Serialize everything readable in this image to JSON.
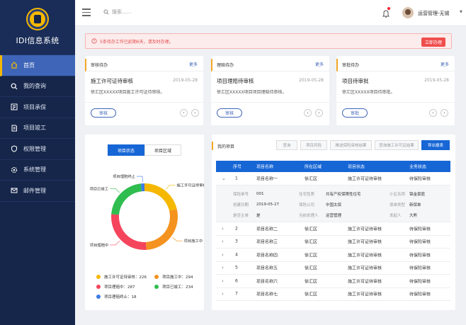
{
  "app": {
    "name": "IDI信息系统"
  },
  "sidebar": {
    "items": [
      {
        "label": "首页",
        "icon": "home-icon",
        "active": true
      },
      {
        "label": "我的查询",
        "icon": "search-icon"
      },
      {
        "label": "项目承保",
        "icon": "document-icon"
      },
      {
        "label": "项目竣工",
        "icon": "file-icon"
      },
      {
        "label": "权限管理",
        "icon": "shield-icon"
      },
      {
        "label": "系统管理",
        "icon": "gear-icon"
      },
      {
        "label": "邮件管理",
        "icon": "mail-icon"
      }
    ]
  },
  "topbar": {
    "search_placeholder": "搜索......",
    "user": "运营管理-无锡"
  },
  "alert": {
    "text": "5条待办工作已延期6天，请及时办理。",
    "action": "立即办理"
  },
  "tasks": [
    {
      "header": "审核待办",
      "more": "更多",
      "title": "施工许可证待审核",
      "date": "2019-05-28",
      "desc": "徐汇区XXXXX项目施工许可证待审核。",
      "button": "审核"
    },
    {
      "header": "理赔待办",
      "more": "更多",
      "title": "项目理赔待审核",
      "date": "2019-05-28",
      "desc": "徐汇区XXXXX项目项目理赔待审核。",
      "button": "审核"
    },
    {
      "header": "审批待办",
      "more": "更多",
      "title": "项目待审批",
      "date": "2019-05-28",
      "desc": "徐汇区XXXXX项目待审批。",
      "button": "审批"
    }
  ],
  "pager": {
    "prev": "‹",
    "next": "›"
  },
  "status_chart": {
    "tabs": [
      "项目状态",
      "项目区域"
    ],
    "chart_data": {
      "type": "pie",
      "categories": [
        "施工许可证待审核",
        "项目施工中",
        "项目理赔中",
        "项目已竣工",
        "项目理赔终止"
      ],
      "values": [
        226,
        294,
        287,
        234,
        18
      ],
      "colors": [
        "#f5b800",
        "#f4931f",
        "#f5455c",
        "#2fbd4f",
        "#3f7be6"
      ],
      "legend": [
        "施工许可证待审核：226",
        "项目施工中：294",
        "项目理赔中：287",
        "项目已竣工：234",
        "项目理赔终止：18"
      ],
      "legend_position": "bottom"
    }
  },
  "projects": {
    "title": "我的项目",
    "toolbar": [
      "查询",
      "项目风险",
      "推送保险审核结果",
      "查询施工许可证结果",
      "导出报表"
    ],
    "columns": [
      "序号",
      "项目名称",
      "所在区域",
      "项目状态",
      "业务状态"
    ],
    "rows": [
      [
        "1",
        "项目名称一",
        "徐汇区",
        "施工许可证待审核",
        "待保险审核"
      ],
      [
        "2",
        "项目名称二",
        "徐汇区",
        "施工许可证待审核",
        "待保险审核"
      ],
      [
        "3",
        "项目名称三",
        "徐汇区",
        "施工许可证待审核",
        "待保险审核"
      ],
      [
        "4",
        "项目名称四",
        "徐汇区",
        "施工许可证待审核",
        "待保险审核"
      ],
      [
        "5",
        "项目名称五",
        "徐汇区",
        "施工许可证待审核",
        "待保险审核"
      ],
      [
        "6",
        "项目名称六",
        "徐汇区",
        "施工许可证待审核",
        "待保险审核"
      ],
      [
        "7",
        "项目名称七",
        "徐汇区",
        "施工许可证待审核",
        "待保险审核"
      ]
    ],
    "detail": [
      [
        [
          "保险单号",
          "001"
        ],
        [
          "住宅性质",
          "共有产权保障性住宅"
        ],
        [
          "小区名称",
          "锦金豪庭"
        ]
      ],
      [
        [
          "创建日期",
          "2019-05-27"
        ],
        [
          "保险公司",
          "中国太保"
        ],
        [
          "保单类型",
          "新保单"
        ]
      ],
      [
        [
          "是否主单",
          "是"
        ],
        [
          "当前处理人",
          "运营管理"
        ],
        [
          "发起人",
          "大熊"
        ]
      ]
    ]
  }
}
